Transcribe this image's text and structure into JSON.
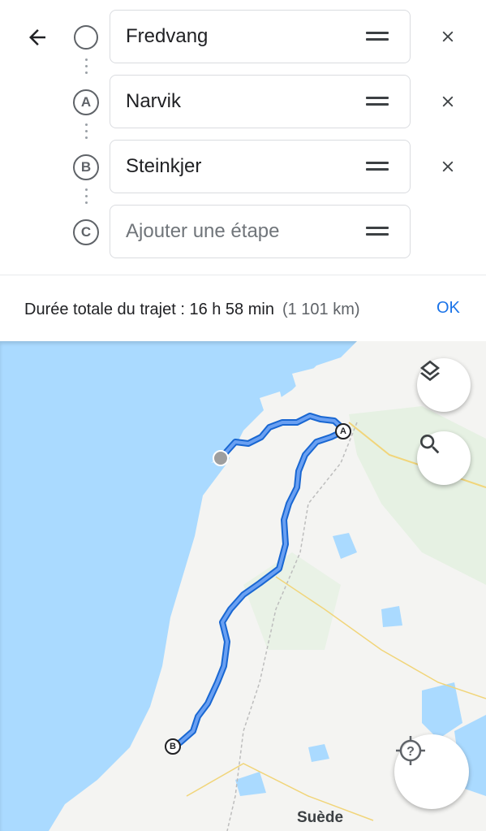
{
  "header": {
    "back_icon": "arrow-left-icon"
  },
  "waypoints": [
    {
      "marker": "",
      "value": "Fredvang",
      "placeholder": ""
    },
    {
      "marker": "A",
      "value": "Narvik",
      "placeholder": ""
    },
    {
      "marker": "B",
      "value": "Steinkjer",
      "placeholder": ""
    },
    {
      "marker": "C",
      "value": "",
      "placeholder": "Ajouter une étape"
    }
  ],
  "summary": {
    "duration": "Durée totale du trajet : 16 h 58 min",
    "distance": "(1 101 km)",
    "ok_label": "OK"
  },
  "map": {
    "country_label": "Suède",
    "route_markers": [
      "A",
      "B"
    ],
    "controls": [
      "layers-icon",
      "search-icon",
      "location-unknown-icon"
    ]
  },
  "colors": {
    "accent": "#1a73e8",
    "route": "#4285f4",
    "water": "#aadaff",
    "land": "#f5f5f5"
  }
}
